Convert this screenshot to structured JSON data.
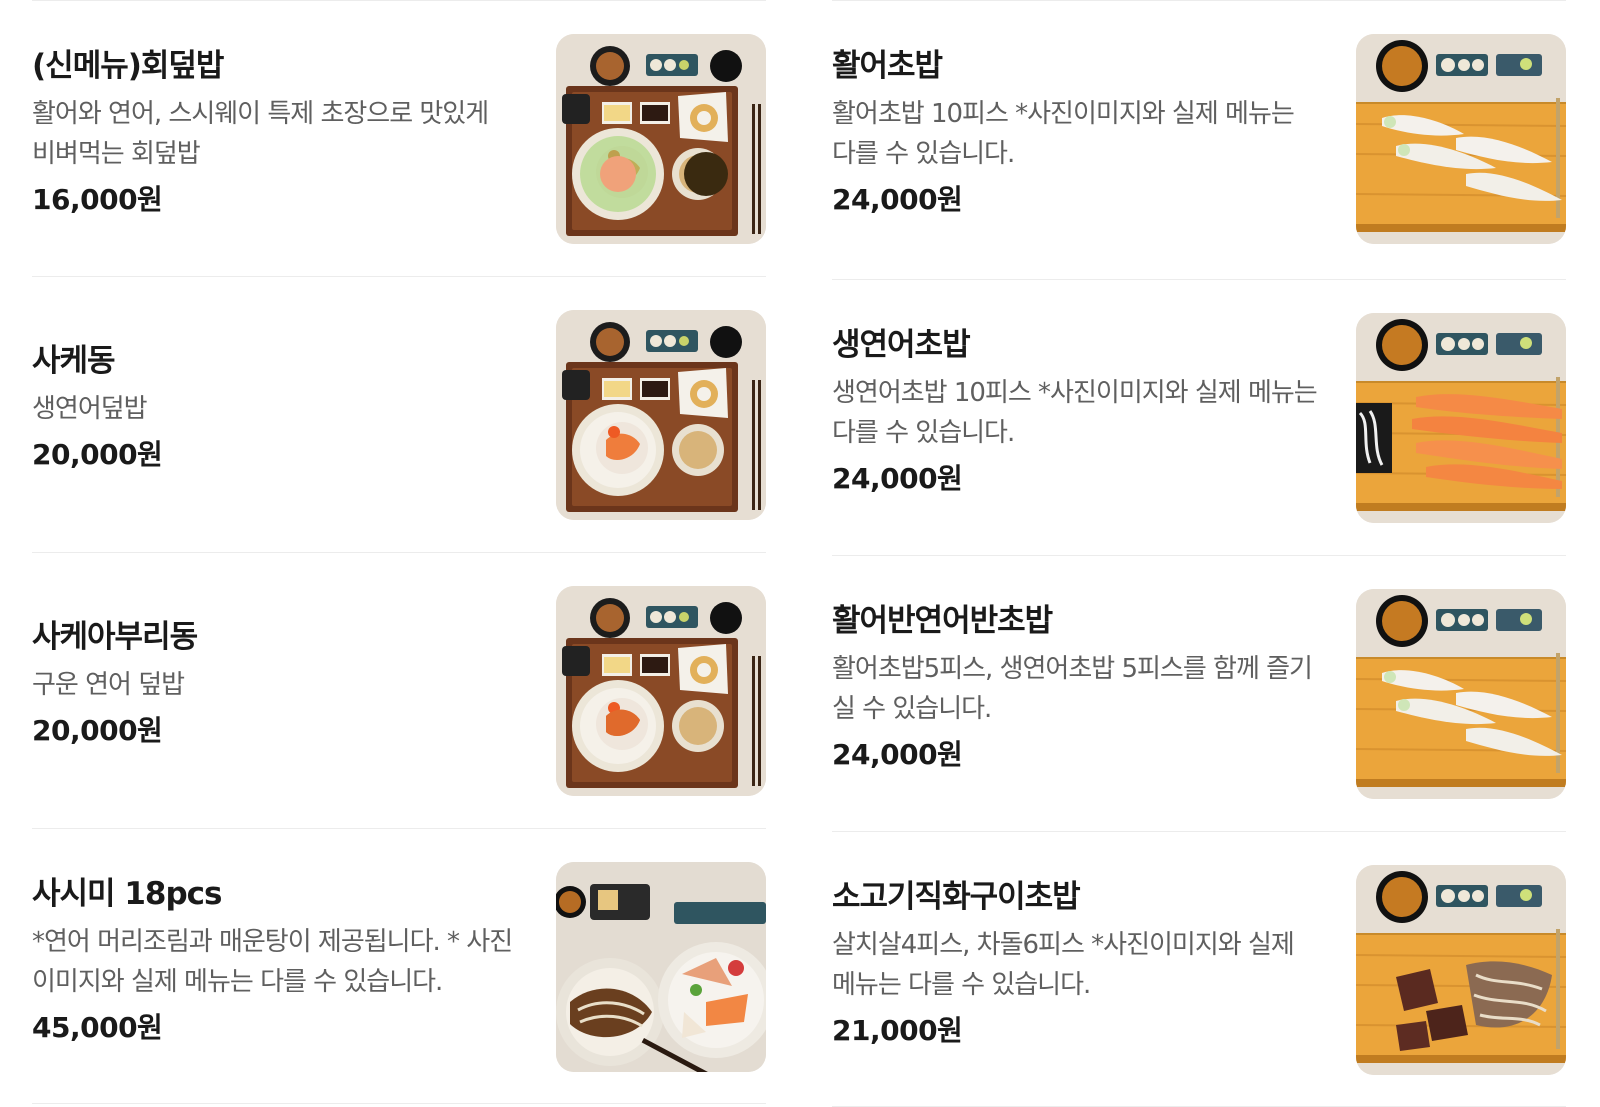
{
  "menu": {
    "left": [
      {
        "name": "(신메뉴)회덮밥",
        "desc": "활어와 연어, 스시웨이 특제 초장으로 맛있게 비벼먹는 회덮밥",
        "price": "16,000원",
        "image": "hoedeopbap-photo"
      },
      {
        "name": "사케동",
        "desc": "생연어덮밥",
        "price": "20,000원",
        "image": "sake-don-photo"
      },
      {
        "name": "사케아부리동",
        "desc": "구운 연어 덮밥",
        "price": "20,000원",
        "image": "sake-aburi-don-photo"
      },
      {
        "name": "사시미 18pcs",
        "desc": "*연어 머리조림과 매운탕이 제공됩니다. * 사진이미지와 실제 메뉴는 다를 수 있습니다.",
        "price": "45,000원",
        "image": "sashimi-photo"
      }
    ],
    "right": [
      {
        "name": "활어초밥",
        "desc": "활어초밥 10피스 *사진이미지와 실제 메뉴는 다를 수 있습니다.",
        "price": "24,000원",
        "image": "halibut-sushi-photo"
      },
      {
        "name": "생연어초밥",
        "desc": "생연어초밥 10피스 *사진이미지와 실제 메뉴는 다를 수 있습니다.",
        "price": "24,000원",
        "image": "salmon-sushi-photo"
      },
      {
        "name": "활어반연어반초밥",
        "desc": "활어초밥5피스, 생연어초밥 5피스를 함께 즐기실 수 있습니다.",
        "price": "24,000원",
        "image": "half-half-sushi-photo"
      },
      {
        "name": "소고기직화구이초밥",
        "desc": "살치살4피스, 차돌6피스 *사진이미지와 실제 메뉴는 다를 수 있습니다.",
        "price": "21,000원",
        "image": "beef-sushi-photo"
      }
    ]
  },
  "colors": {
    "title": "#1a1a1a",
    "description": "#5f5f5f",
    "divider": "#ececec",
    "tray_wood": "#7a3e1f",
    "sushi_board": "#e8a93a",
    "salmon": "#f08a4b"
  }
}
